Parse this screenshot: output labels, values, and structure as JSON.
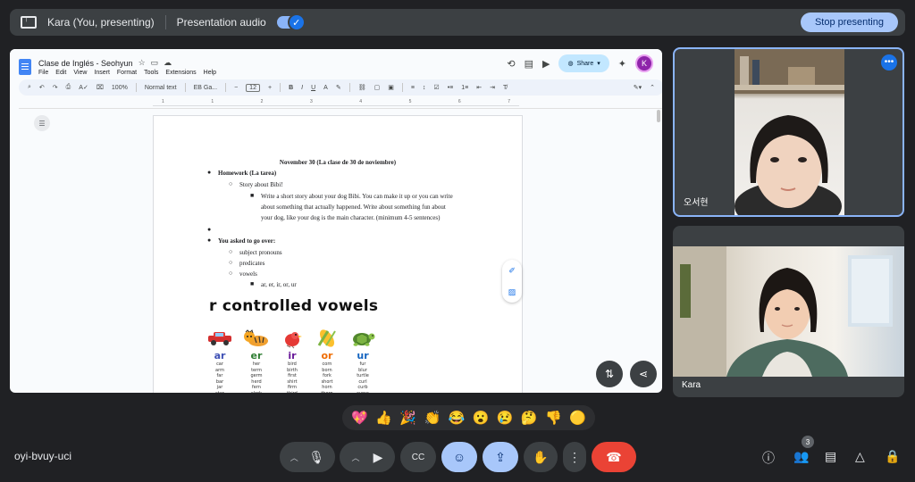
{
  "present_bar": {
    "presenter": "Kara (You, presenting)",
    "audio_label": "Presentation audio",
    "stop_label": "Stop presenting"
  },
  "doc": {
    "title": "Clase de Inglés - Seohyun",
    "menu": [
      "File",
      "Edit",
      "View",
      "Insert",
      "Format",
      "Tools",
      "Extensions",
      "Help"
    ],
    "share_label": "Share",
    "avatar_letter": "K",
    "toolbar": {
      "zoom": "100%",
      "style": "Normal text",
      "font": "EB Ga...",
      "font_size": "12"
    },
    "ruler_marks": [
      "1",
      "1",
      "2",
      "3",
      "4",
      "5",
      "6",
      "7"
    ],
    "heading": "November 30 (La clase de 30 de noviembre)",
    "lines": {
      "homework": "Homework (La tarea)",
      "story": "Story about Bibi!",
      "task1": "Write a short story about your dog Bibi. You can make it up or you can write",
      "task2": "about something that actually happened. Write about something fun about",
      "task3": "your dog, like your dog is the main character. (minimum 4-5 sentences)",
      "asked": "You asked to go over:",
      "sub1": "subject pronouns",
      "sub2": "predicates",
      "sub3": "vowels",
      "sub4": "ar, er, ir, or, ur"
    },
    "vowel_title": "r controlled vowels",
    "vowels": [
      {
        "head": "ar",
        "color": "#3f51b5",
        "words": [
          "car",
          "arm",
          "far",
          "bar",
          "jar",
          "star"
        ]
      },
      {
        "head": "er",
        "color": "#2e7d32",
        "words": [
          "her",
          "term",
          "germ",
          "herd",
          "fern",
          "clerk"
        ]
      },
      {
        "head": "ir",
        "color": "#6a1b9a",
        "words": [
          "bird",
          "birth",
          "first",
          "shirt",
          "firm",
          "third"
        ]
      },
      {
        "head": "or",
        "color": "#ef6c00",
        "words": [
          "corn",
          "born",
          "fork",
          "short",
          "horn",
          "thorn"
        ]
      },
      {
        "head": "ur",
        "color": "#1565c0",
        "words": [
          "fur",
          "blur",
          "turtle",
          "curl",
          "curb",
          "curse"
        ]
      }
    ]
  },
  "participants": {
    "tile_a_name": "오서현",
    "tile_b_name": "Kara"
  },
  "reactions": [
    "💖",
    "👍",
    "🎉",
    "👏",
    "😂",
    "😮",
    "😢",
    "🤔",
    "👎",
    "🟡"
  ],
  "meeting_code": "oyi-bvuy-uci",
  "people_count": "3",
  "icons": {
    "mic": "microphone-icon",
    "camera": "camera-icon",
    "captions": "captions-icon",
    "emoji": "emoji-icon",
    "present": "present-icon",
    "hand": "raise-hand-icon",
    "more": "more-options-icon",
    "end": "end-call-icon",
    "info": "info-icon",
    "people": "people-icon",
    "chat": "chat-icon",
    "activities": "activities-icon",
    "host": "host-controls-icon"
  },
  "colors": {
    "accent": "#a8c7fa",
    "end_call": "#ea4335",
    "background": "#202124"
  }
}
